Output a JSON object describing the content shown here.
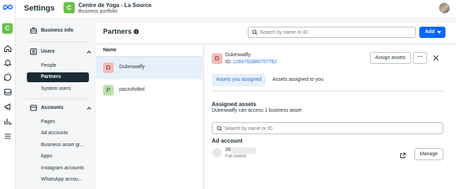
{
  "header": {
    "title": "Settings",
    "portfolio_initial": "C",
    "portfolio_name": "Centre de Yoga - La Source",
    "portfolio_type": "Business portfolio"
  },
  "rail": {
    "portfolio_initial": "C",
    "icons": [
      "meta-logo-icon",
      "home-icon",
      "bell-icon",
      "chat-icon",
      "inbox-icon",
      "megaphone-icon",
      "bar-chart-icon",
      "menu-icon"
    ]
  },
  "nav": {
    "business_info": "Business info",
    "users": {
      "label": "Users",
      "items": [
        "People",
        "Partners",
        "System users"
      ]
    },
    "accounts": {
      "label": "Accounts",
      "items": [
        "Pages",
        "Ad accounts",
        "Business asset gr...",
        "Apps",
        "Instagram accounts",
        "WhatsApp accou..."
      ]
    }
  },
  "partners": {
    "title": "Partners",
    "search_placeholder": "Search by name or ID",
    "add_label": "Add",
    "column_header": "Name",
    "rows": [
      {
        "initial": "D",
        "name": "Dukeswaffy",
        "color": "#f7b7b4"
      },
      {
        "initial": "P",
        "name": "pazzofutbol",
        "color": "#b9e3a5"
      }
    ]
  },
  "detail": {
    "initial": "D",
    "name": "Dukeswaffy",
    "id_label": "ID:",
    "id_value": "1266762886757762",
    "assign_label": "Assign assets",
    "more_label": "···",
    "tabs": [
      "Assets you assigned",
      "Assets assigned to you"
    ],
    "assigned_heading": "Assigned assets",
    "assigned_sub": "Dukeswaffy can access 1 business asset",
    "search_placeholder": "Search by name or ID",
    "ad_account_heading": "Ad account",
    "account_name": "39",
    "account_permission": "Full control",
    "manage_label": "Manage"
  },
  "colors": {
    "accent": "#0866ff",
    "link": "#216fdb",
    "selected_row": "#e7f0fa",
    "active_nav": "#1c2b33",
    "portfolio": "#6cc04a"
  }
}
